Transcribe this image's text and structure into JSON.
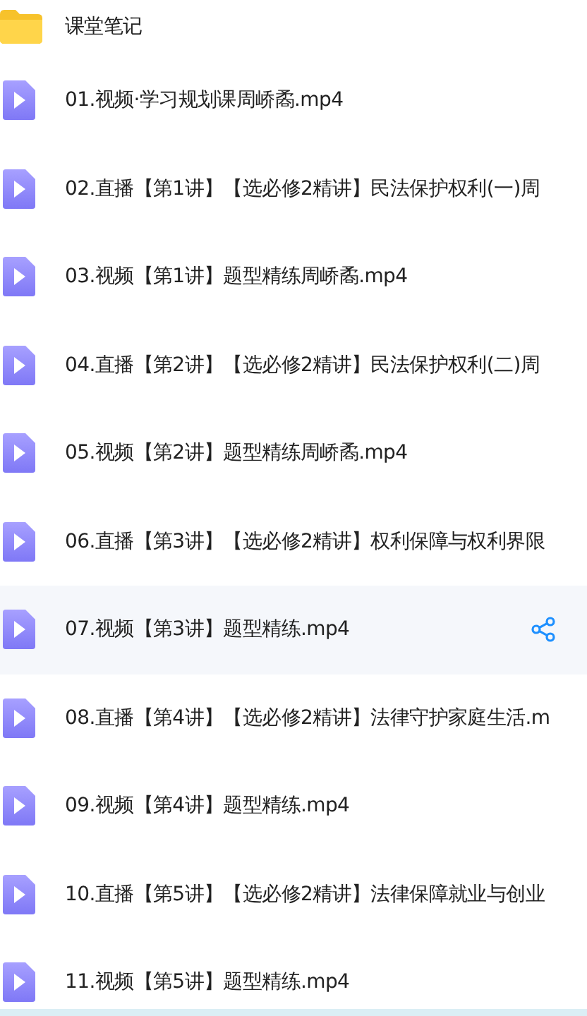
{
  "files": [
    {
      "kind": "folder",
      "name": "课堂笔记",
      "highlighted": false
    },
    {
      "kind": "video",
      "name": "01.视频·学习规划课周峤矞.mp4",
      "highlighted": false
    },
    {
      "kind": "video",
      "name": "02.直播【第1讲】【选必修2精讲】民法保护权利(一)周",
      "highlighted": false
    },
    {
      "kind": "video",
      "name": "03.视频【第1讲】题型精练周峤矞.mp4",
      "highlighted": false
    },
    {
      "kind": "video",
      "name": "04.直播【第2讲】【选必修2精讲】民法保护权利(二)周",
      "highlighted": false
    },
    {
      "kind": "video",
      "name": "05.视频【第2讲】题型精练周峤矞.mp4",
      "highlighted": false
    },
    {
      "kind": "video",
      "name": "06.直播【第3讲】【选必修2精讲】权利保障与权利界限",
      "highlighted": false
    },
    {
      "kind": "video",
      "name": "07.视频【第3讲】题型精练.mp4",
      "highlighted": true
    },
    {
      "kind": "video",
      "name": "08.直播【第4讲】【选必修2精讲】法律守护家庭生活.m",
      "highlighted": false
    },
    {
      "kind": "video",
      "name": "09.视频【第4讲】题型精练.mp4",
      "highlighted": false
    },
    {
      "kind": "video",
      "name": "10.直播【第5讲】【选必修2精讲】法律保障就业与创业",
      "highlighted": false
    },
    {
      "kind": "video",
      "name": "11.视频【第5讲】题型精练.mp4",
      "highlighted": false
    }
  ]
}
